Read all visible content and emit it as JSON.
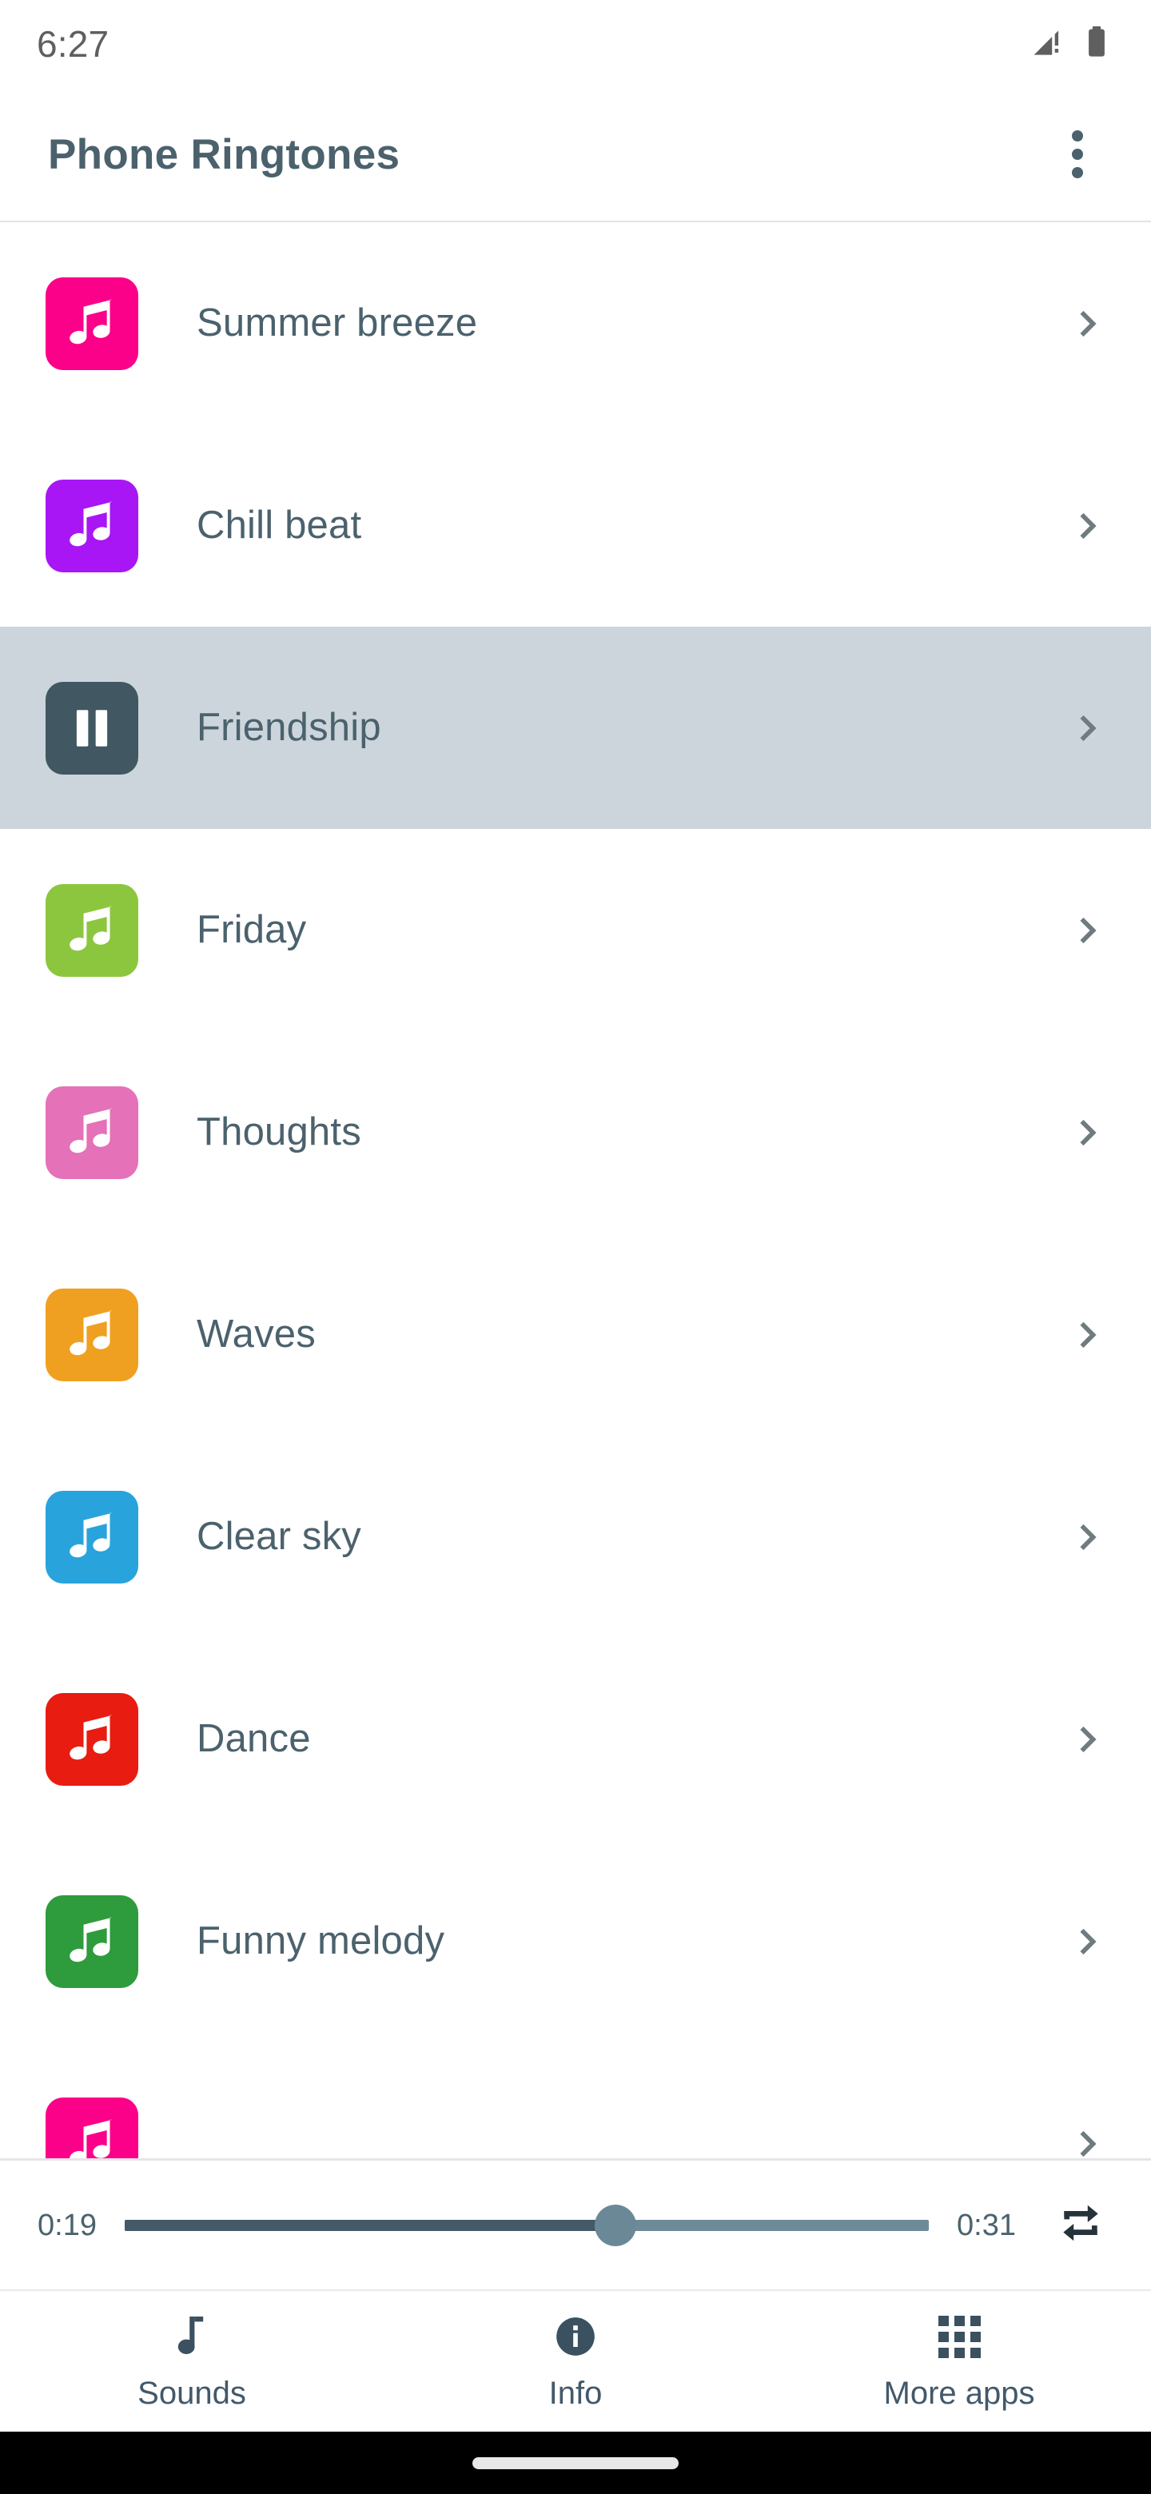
{
  "status_bar": {
    "time": "6:27",
    "icons": [
      {
        "name": "signal-warning-icon"
      },
      {
        "name": "battery-icon"
      }
    ]
  },
  "app_bar": {
    "title": "Phone Ringtones",
    "overflow_label": "More options",
    "title_color": "#4b626d"
  },
  "list": {
    "rows": [
      {
        "label": "Summer breeze",
        "icon": "music-note-icon",
        "color": "#FB0089",
        "state": "idle"
      },
      {
        "label": "Chill beat",
        "icon": "music-note-icon",
        "color": "#A816F5",
        "state": "idle"
      },
      {
        "label": "Friendship",
        "icon": "pause-icon",
        "color": "#415761",
        "state": "playing"
      },
      {
        "label": "Friday",
        "icon": "music-note-icon",
        "color": "#8CC63E",
        "state": "idle"
      },
      {
        "label": "Thoughts",
        "icon": "music-note-icon",
        "color": "#E571B8",
        "state": "idle"
      },
      {
        "label": "Waves",
        "icon": "music-note-icon",
        "color": "#F0A020",
        "state": "idle"
      },
      {
        "label": "Clear sky",
        "icon": "music-note-icon",
        "color": "#29A3DC",
        "state": "idle"
      },
      {
        "label": "Dance",
        "icon": "music-note-icon",
        "color": "#E81C10",
        "state": "idle"
      },
      {
        "label": "Funny melody",
        "icon": "music-note-icon",
        "color": "#2E9B3C",
        "state": "idle"
      },
      {
        "label": "",
        "icon": "music-note-icon",
        "color": "#FB0089",
        "state": "clipped"
      }
    ],
    "selected_index": 2,
    "selected_background": "#ccd5dc",
    "chevron_icon": "chevron-right-icon"
  },
  "player": {
    "elapsed": "0:19",
    "duration": "0:31",
    "progress_percent": 61,
    "repeat_icon": "repeat-icon",
    "repeat_enabled": true,
    "fill_color": "#445a66",
    "track_color": "#6e8a98",
    "thumb_color": "#6b8897"
  },
  "bottom_nav": {
    "items": [
      {
        "label": "Sounds",
        "icon": "music-note-single-icon",
        "active": true
      },
      {
        "label": "Info",
        "icon": "info-circle-icon",
        "active": false
      },
      {
        "label": "More apps",
        "icon": "apps-grid-icon",
        "active": false
      }
    ],
    "color": "#42596a"
  },
  "gesture_bar": {
    "handle": "home-gesture-pill"
  }
}
